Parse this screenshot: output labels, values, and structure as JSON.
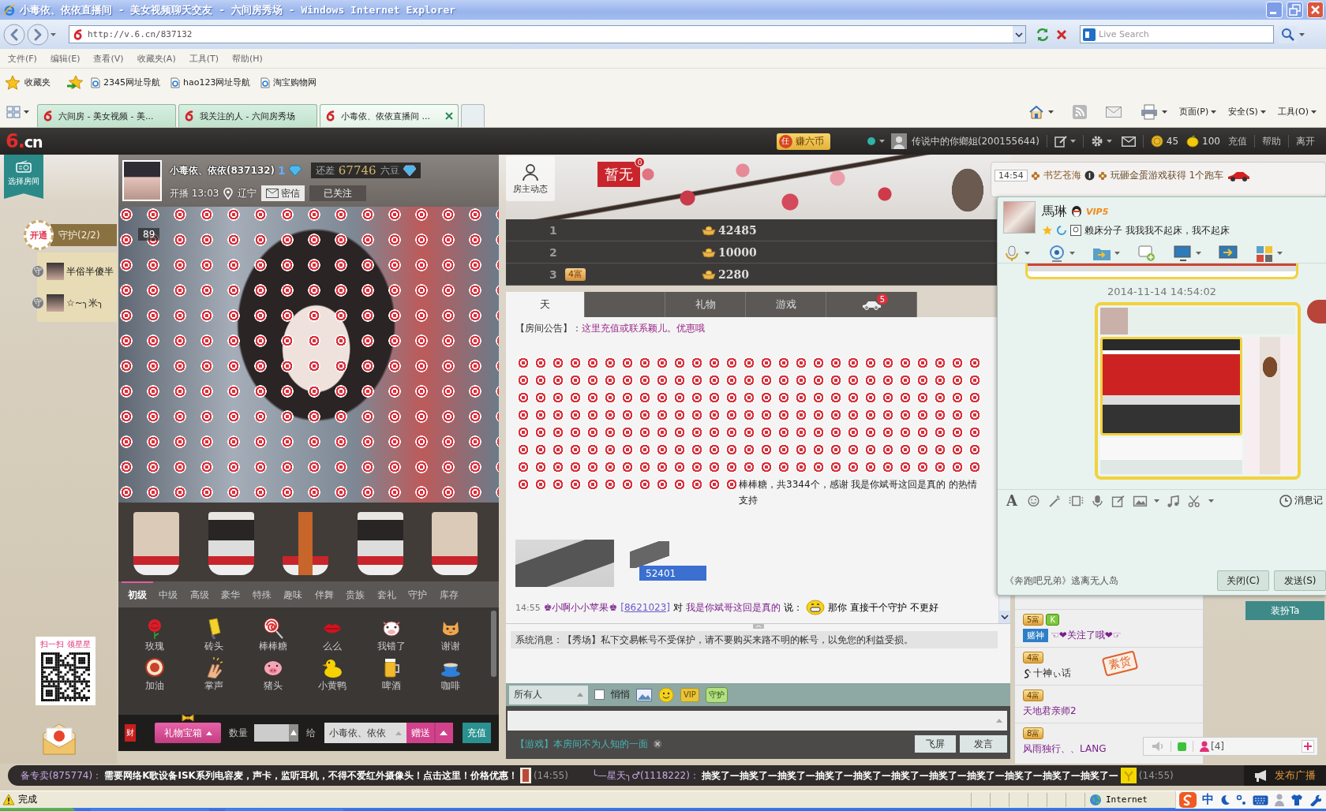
{
  "window": {
    "title": "小毒依、依依直播间 - 美女视频聊天交友 - 六间房秀场 - Windows Internet Explorer"
  },
  "address_bar": {
    "url": "http://v.6.cn/837132",
    "search_placeholder": "Live Search"
  },
  "menu_bar": [
    "文件(F)",
    "编辑(E)",
    "查看(V)",
    "收藏夹(A)",
    "工具(T)",
    "帮助(H)"
  ],
  "favorites_bar": {
    "label": "收藏夹",
    "links": [
      "2345网址导航",
      "hao123网址导航",
      "淘宝购物网"
    ]
  },
  "browser_tabs": [
    {
      "label": "六间房 - 美女视频 - 美...",
      "selected": false
    },
    {
      "label": "我关注的人 - 六间房秀场",
      "selected": false
    },
    {
      "label": "小毒依、依依直播间 ...",
      "selected": true
    }
  ],
  "command_bar": [
    "页面(P)",
    "安全(S)",
    "工具(O)"
  ],
  "site_bar": {
    "logo": "6.cn",
    "task_mark": "任",
    "earn": "赚六币",
    "user": "传说中的你鄉姐(200155644)",
    "coins": "45",
    "beans": "100",
    "links": [
      "充值",
      "帮助",
      "离开"
    ]
  },
  "sidebar": {
    "room_select": "选择房间",
    "guard_open": "开通",
    "guard_title": "守护(2/2)",
    "guards": [
      {
        "mark": "守",
        "name": "半俗半傻半"
      },
      {
        "mark": "守",
        "name": "☆~╮米╮"
      }
    ],
    "qr_caption": "扫一扫 领星星"
  },
  "host": {
    "name": "小毒依、依依(837132)",
    "level": "1",
    "need_label": "还差",
    "need_beans": "67746",
    "bean_unit": "六豆",
    "start": "开播 13:03",
    "location": "辽宁",
    "message": "密信",
    "follow": "已关注",
    "viewers": "89"
  },
  "gift_tabs": [
    {
      "label": "初级",
      "selected": true
    },
    {
      "label": "中级",
      "selected": false
    },
    {
      "label": "高级",
      "selected": false
    },
    {
      "label": "豪华",
      "selected": false
    },
    {
      "label": "特殊",
      "selected": false
    },
    {
      "label": "趣味",
      "selected": false
    },
    {
      "label": "伴舞",
      "selected": false
    },
    {
      "label": "贵族",
      "selected": false
    },
    {
      "label": "套礼",
      "selected": false
    },
    {
      "label": "守护",
      "selected": false
    },
    {
      "label": "库存",
      "selected": false
    }
  ],
  "gifts": [
    {
      "kind": "rose",
      "name": "玫瑰"
    },
    {
      "kind": "brick",
      "name": "砖头"
    },
    {
      "kind": "lollipop",
      "name": "棒棒糖"
    },
    {
      "kind": "kiss",
      "name": "么么"
    },
    {
      "kind": "cow",
      "name": "我错了"
    },
    {
      "kind": "cat",
      "name": "谢谢"
    },
    {
      "kind": "cheer",
      "name": "加油"
    },
    {
      "kind": "clap",
      "name": "掌声"
    },
    {
      "kind": "pig",
      "name": "猪头"
    },
    {
      "kind": "duck",
      "name": "小黄鸭"
    },
    {
      "kind": "beer",
      "name": "啤酒"
    },
    {
      "kind": "coffee",
      "name": "咖啡"
    }
  ],
  "gift_bar": {
    "fortune": "财",
    "box": "礼物宝箱",
    "quantity_label": "数量",
    "to_label": "给",
    "recipient": "小毒依、依依",
    "send": "赠送",
    "recharge": "充值"
  },
  "owner_news": "房主动态",
  "rank_flag": {
    "text": "暂无",
    "count": "0"
  },
  "ranking": [
    {
      "rank": "1",
      "amount": "42485"
    },
    {
      "rank": "2",
      "amount": "10000"
    },
    {
      "rank": "3",
      "badge": "4富",
      "amount": "2280"
    }
  ],
  "chat_tabs": [
    {
      "kind": "text",
      "label": "天",
      "selected": true
    },
    {
      "kind": "blank",
      "selected": false
    },
    {
      "kind": "text",
      "label": "礼物",
      "selected": false
    },
    {
      "kind": "text",
      "label": "游戏",
      "selected": false
    },
    {
      "kind": "car",
      "badge": "5",
      "selected": false
    }
  ],
  "chat_messages": [
    {
      "kind": "notice",
      "label": "【房间公告】：",
      "text": "这里充值或联系颖儿。优惠哦"
    },
    {
      "kind": "gift",
      "text": "棒棒糖，共3344个，感谢 我是你斌哥这回是真的 的热情支持"
    },
    {
      "kind": "image",
      "caption": "52401"
    },
    {
      "kind": "speech",
      "time": "14:55",
      "sender": "♚小啊小小苹果♚",
      "id": "[8621023]",
      "verb": "对",
      "target": "我是你斌哥这回是真的",
      "say": "说：",
      "text": "那你 直接干个守护 不更好"
    }
  ],
  "system_message": "系统消息：【秀场】私下交易帐号不受保护，请不要购买来路不明的帐号，以免您的利益受损。",
  "chat_input": {
    "audience": "所有人",
    "whisper": {
      "label": "悄悄",
      "checked": false
    },
    "vip": "VIP",
    "guard": "守护",
    "game_link": "【游戏】本房间不为人知的一面",
    "buttons": [
      "飞屏",
      "发言"
    ]
  },
  "notifications": [
    {
      "time": "14:54",
      "user": "书艺苍海",
      "text": "玩砸金蛋游戏获得 1个跑车"
    }
  ],
  "qq_window": {
    "name": "馬琳",
    "vip": "VIP5",
    "signature": "赖床分子 我我我不起床，我不起床",
    "timestamp": "2014-11-14 14:54:02",
    "font_button": "A",
    "history": "消息记",
    "footer": "《奔跑吧兄弟》逃离无人岛",
    "buttons": [
      "关闭(C)",
      "发送(S)"
    ]
  },
  "decorate_button": "装扮Ta",
  "user_list": [
    {
      "badges": [
        {
          "kind": "wealth",
          "text": "5富"
        },
        {
          "kind": "level",
          "text": "K"
        }
      ],
      "title_badge": "赌神",
      "name": "☜❤关注了哦❤☞",
      "color": "#7a1f8a"
    },
    {
      "badges": [
        {
          "kind": "wealth",
          "text": "4富"
        }
      ],
      "decorated": true,
      "name": "十神ぃ话",
      "stamp": "素货"
    },
    {
      "badges": [
        {
          "kind": "wealth",
          "text": "4富"
        }
      ],
      "name": "天地君亲师2",
      "color": "#7a1f8a"
    },
    {
      "badges": [
        {
          "kind": "wealth",
          "text": "8富"
        }
      ],
      "name": "风雨独行、、LANG",
      "color": "#7a1f8a"
    }
  ],
  "mini_bar": {
    "members": "[4]"
  },
  "ticker": [
    {
      "kind": "ad",
      "user": "备专卖(875774)：",
      "text": "需要网络K歌设备ISK系列电容麦，声卡，监听耳机，不得不爱红外摄像头！点击这里！价格优惠！",
      "time": "(14:55)"
    },
    {
      "kind": "user",
      "user": "╰—星天╮♂(1118222)：",
      "text": "抽奖了—抽奖了—抽奖了—抽奖了—抽奖了—抽奖了—抽奖了—抽奖了—抽奖了—抽奖了—抽奖了—",
      "time": "(14:55)"
    }
  ],
  "broadcast": "发布广播",
  "status_bar": {
    "text": "完成",
    "zone": "Internet",
    "ime": "中"
  }
}
